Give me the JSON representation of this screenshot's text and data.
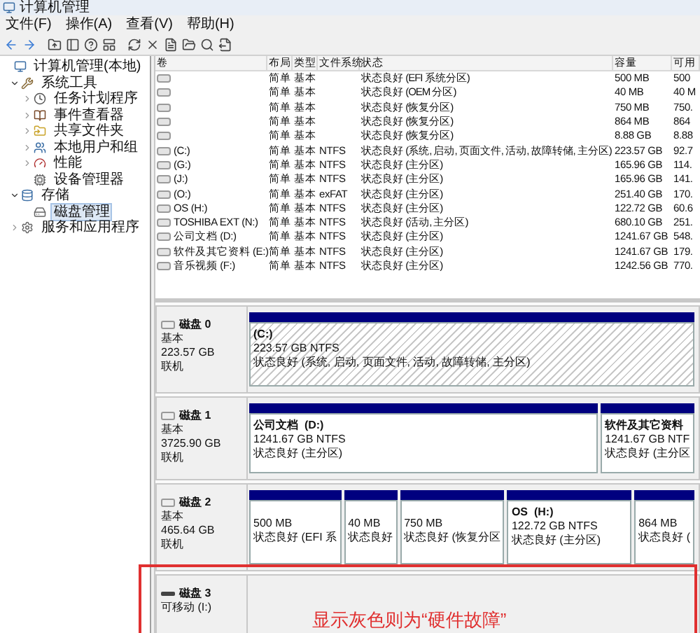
{
  "window": {
    "title": "计算机管理"
  },
  "menu": [
    "文件(F)",
    "操作(A)",
    "查看(V)",
    "帮助(H)"
  ],
  "tree": [
    {
      "label": "计算机管理(本地)",
      "kind": "computer",
      "selected": false,
      "children": [
        {
          "label": "系统工具",
          "kind": "tools",
          "selected": false,
          "expanded": true,
          "children": [
            {
              "label": "任务计划程序",
              "kind": "clock",
              "selected": false,
              "expanded": false
            },
            {
              "label": "事件查看器",
              "kind": "log",
              "selected": false,
              "expanded": false
            },
            {
              "label": "共享文件夹",
              "kind": "share",
              "selected": false,
              "expanded": false
            },
            {
              "label": "本地用户和组",
              "kind": "users",
              "selected": false,
              "expanded": false
            },
            {
              "label": "性能",
              "kind": "performance",
              "selected": false,
              "expanded": false
            },
            {
              "label": "设备管理器",
              "kind": "devices",
              "selected": false
            }
          ]
        },
        {
          "label": "存储",
          "kind": "storage",
          "selected": false,
          "expanded": true,
          "children": [
            {
              "label": "磁盘管理",
              "kind": "disk",
              "selected": true
            }
          ]
        },
        {
          "label": "服务和应用程序",
          "kind": "services",
          "selected": false,
          "expanded": false
        }
      ]
    }
  ],
  "table": {
    "columns": [
      "卷",
      "布局",
      "类型",
      "文件系统",
      "状态",
      "容量",
      "可用"
    ],
    "rows": [
      {
        "volume": "",
        "layout": "简单",
        "type": "基本",
        "fs": "",
        "status": "状态良好 (EFI 系统分区)",
        "capacity": "500 MB",
        "free": "500"
      },
      {
        "volume": "",
        "layout": "简单",
        "type": "基本",
        "fs": "",
        "status": "状态良好 (OEM 分区)",
        "capacity": "40 MB",
        "free": "40 M"
      },
      {
        "volume": "",
        "layout": "简单",
        "type": "基本",
        "fs": "",
        "status": "状态良好 (恢复分区)",
        "capacity": "750 MB",
        "free": "750."
      },
      {
        "volume": "",
        "layout": "简单",
        "type": "基本",
        "fs": "",
        "status": "状态良好 (恢复分区)",
        "capacity": "864 MB",
        "free": "864"
      },
      {
        "volume": "",
        "layout": "简单",
        "type": "基本",
        "fs": "",
        "status": "状态良好 (恢复分区)",
        "capacity": "8.88 GB",
        "free": "8.88"
      },
      {
        "volume": "(C:)",
        "layout": "简单",
        "type": "基本",
        "fs": "NTFS",
        "status": "状态良好 (系统, 启动, 页面文件, 活动, 故障转储, 主分区)",
        "capacity": "223.57 GB",
        "free": "92.7"
      },
      {
        "volume": "(G:)",
        "layout": "简单",
        "type": "基本",
        "fs": "NTFS",
        "status": "状态良好 (主分区)",
        "capacity": "165.96 GB",
        "free": "114."
      },
      {
        "volume": "(J:)",
        "layout": "简单",
        "type": "基本",
        "fs": "NTFS",
        "status": "状态良好 (主分区)",
        "capacity": "165.96 GB",
        "free": "141."
      },
      {
        "volume": "(O:)",
        "layout": "简单",
        "type": "基本",
        "fs": "exFAT",
        "status": "状态良好 (主分区)",
        "capacity": "251.40 GB",
        "free": "170."
      },
      {
        "volume": "OS (H:)",
        "layout": "简单",
        "type": "基本",
        "fs": "NTFS",
        "status": "状态良好 (主分区)",
        "capacity": "122.72 GB",
        "free": "60.6"
      },
      {
        "volume": "TOSHIBA EXT (N:)",
        "layout": "简单",
        "type": "基本",
        "fs": "NTFS",
        "status": "状态良好 (活动, 主分区)",
        "capacity": "680.10 GB",
        "free": "251."
      },
      {
        "volume": "公司文档 (D:)",
        "layout": "简单",
        "type": "基本",
        "fs": "NTFS",
        "status": "状态良好 (主分区)",
        "capacity": "1241.67 GB",
        "free": "548."
      },
      {
        "volume": "软件及其它资料 (E:)",
        "layout": "简单",
        "type": "基本",
        "fs": "NTFS",
        "status": "状态良好 (主分区)",
        "capacity": "1241.67 GB",
        "free": "179."
      },
      {
        "volume": "音乐视频 (F:)",
        "layout": "简单",
        "type": "基本",
        "fs": "NTFS",
        "status": "状态良好 (主分区)",
        "capacity": "1242.56 GB",
        "free": "770."
      }
    ]
  },
  "disks": [
    {
      "name": "磁盘 0",
      "kind": "fixed",
      "type": "基本",
      "size": "223.57 GB",
      "status": "联机",
      "partitions": [
        {
          "name": "(C:)",
          "size": "223.57 GB NTFS",
          "status": "状态良好 (系统, 启动, 页面文件, 活动, 故障转储, 主分区)",
          "selected": true
        }
      ]
    },
    {
      "name": "磁盘 1",
      "kind": "fixed",
      "type": "基本",
      "size": "3725.90 GB",
      "status": "联机",
      "partitions": [
        {
          "name": "公司文档  (D:)",
          "size": "1241.67 GB NTFS",
          "status": "状态良好 (主分区)",
          "selected": false
        },
        {
          "name": "软件及其它资料",
          "size": "1241.67 GB NTF",
          "status": "状态良好 (主分区",
          "selected": false
        }
      ]
    },
    {
      "name": "磁盘 2",
      "kind": "fixed",
      "type": "基本",
      "size": "465.64 GB",
      "status": "联机",
      "partitions": [
        {
          "size": "500 MB",
          "status": "状态良好 (EFI 系",
          "selected": false
        },
        {
          "size": "40 MB",
          "status": "状态良好",
          "selected": false
        },
        {
          "size": "750 MB",
          "status": "状态良好 (恢复分区",
          "selected": false
        },
        {
          "name": "OS  (H:)",
          "size": "122.72 GB NTFS",
          "status": "状态良好 (主分区)",
          "selected": false
        },
        {
          "size": "864 MB",
          "status": "状态良好 (",
          "selected": false
        }
      ]
    },
    {
      "name": "磁盘 3",
      "kind": "removable",
      "type": "可移动 (I:)"
    }
  ],
  "annotation": {
    "text": "显示灰色则为“硬件故障”"
  }
}
